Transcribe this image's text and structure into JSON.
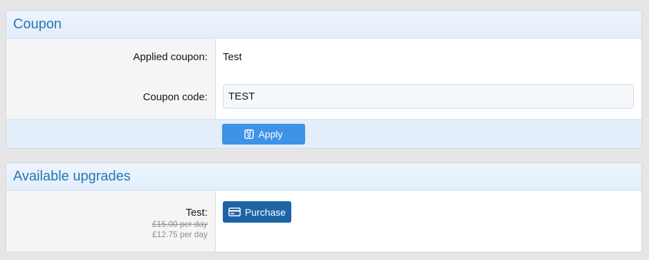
{
  "coupon": {
    "title": "Coupon",
    "applied_label": "Applied coupon:",
    "applied_value": "Test",
    "code_label": "Coupon code:",
    "code_value": "TEST",
    "apply_label": "Apply",
    "apply_icon": "save-icon",
    "accent_color": "#3d93e6"
  },
  "upgrades": {
    "title": "Available upgrades",
    "items": [
      {
        "name": "Test:",
        "old_price": "£15.00 per day",
        "new_price": "£12.75 per day",
        "purchase_label": "Purchase",
        "purchase_icon": "credit-card-icon"
      }
    ],
    "button_color": "#1d64a5"
  }
}
